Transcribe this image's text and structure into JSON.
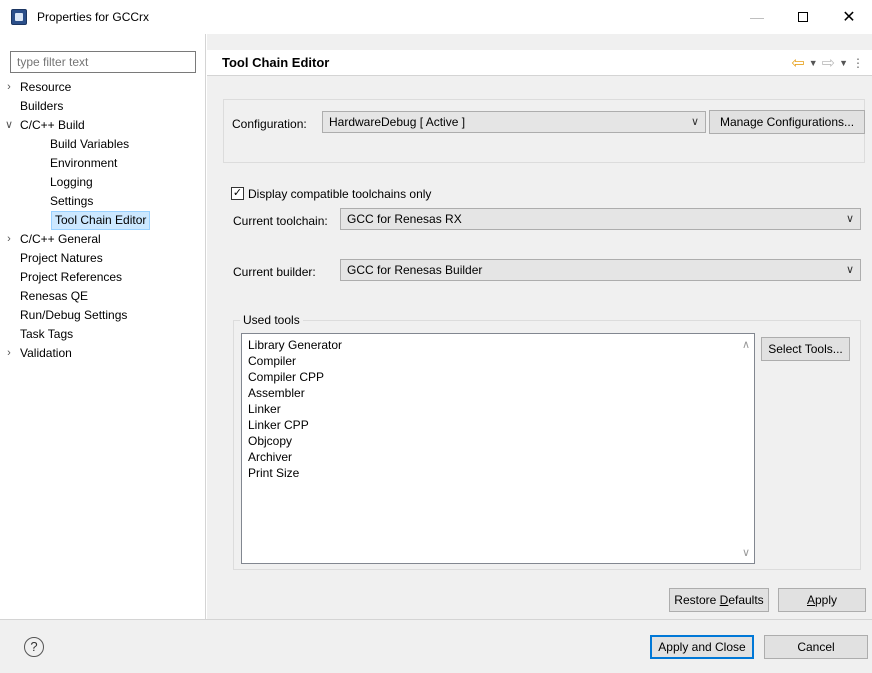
{
  "window": {
    "title": "Properties for GCCrx",
    "minimize_glyph": "—",
    "close_glyph": "✕"
  },
  "filter": {
    "placeholder": "type filter text"
  },
  "tree": [
    {
      "label": "Resource",
      "expandable": true,
      "expanded": false,
      "level": 0
    },
    {
      "label": "Builders",
      "expandable": false,
      "level": 0
    },
    {
      "label": "C/C++ Build",
      "expandable": true,
      "expanded": true,
      "level": 0
    },
    {
      "label": "Build Variables",
      "level": 1
    },
    {
      "label": "Environment",
      "level": 1
    },
    {
      "label": "Logging",
      "level": 1
    },
    {
      "label": "Settings",
      "level": 1
    },
    {
      "label": "Tool Chain Editor",
      "level": 1,
      "selected": true
    },
    {
      "label": "C/C++ General",
      "expandable": true,
      "expanded": false,
      "level": 0
    },
    {
      "label": "Project Natures",
      "level": 0
    },
    {
      "label": "Project References",
      "level": 0
    },
    {
      "label": "Renesas QE",
      "level": 0
    },
    {
      "label": "Run/Debug Settings",
      "level": 0
    },
    {
      "label": "Task Tags",
      "level": 0
    },
    {
      "label": "Validation",
      "expandable": true,
      "expanded": false,
      "level": 0
    }
  ],
  "header": {
    "title": "Tool Chain Editor",
    "back_glyph": "⇦",
    "forward_glyph": "⇨",
    "dropdown_glyph": "▼",
    "menu_glyph": "⋮"
  },
  "configuration": {
    "label": "Configuration:",
    "value": "HardwareDebug  [ Active ]",
    "manage_button": "Manage Configurations..."
  },
  "compatible_only": {
    "label": "Display compatible toolchains only",
    "checked": true,
    "check_glyph": "✓"
  },
  "toolchain": {
    "label": "Current toolchain:",
    "value": "GCC for Renesas RX"
  },
  "builder": {
    "label": "Current builder:",
    "value": "GCC for Renesas Builder"
  },
  "used_tools": {
    "legend": "Used tools",
    "items": [
      "Library Generator",
      "Compiler",
      "Compiler CPP",
      "Assembler",
      "Linker",
      "Linker CPP",
      "Objcopy",
      "Archiver",
      "Print Size"
    ],
    "select_button": "Select Tools..."
  },
  "page_buttons": {
    "restore_defaults_pre": "Restore ",
    "restore_defaults_mnemonic": "D",
    "restore_defaults_post": "efaults",
    "apply_mnemonic": "A",
    "apply_post": "pply"
  },
  "dialog_buttons": {
    "apply_and_close": "Apply and Close",
    "cancel": "Cancel"
  },
  "help": {
    "glyph": "?"
  },
  "colors": {
    "selection_bg": "#cce8ff",
    "selection_border": "#99d1ff",
    "default_button_border": "#0078d7",
    "back_arrow": "#e8a321"
  }
}
